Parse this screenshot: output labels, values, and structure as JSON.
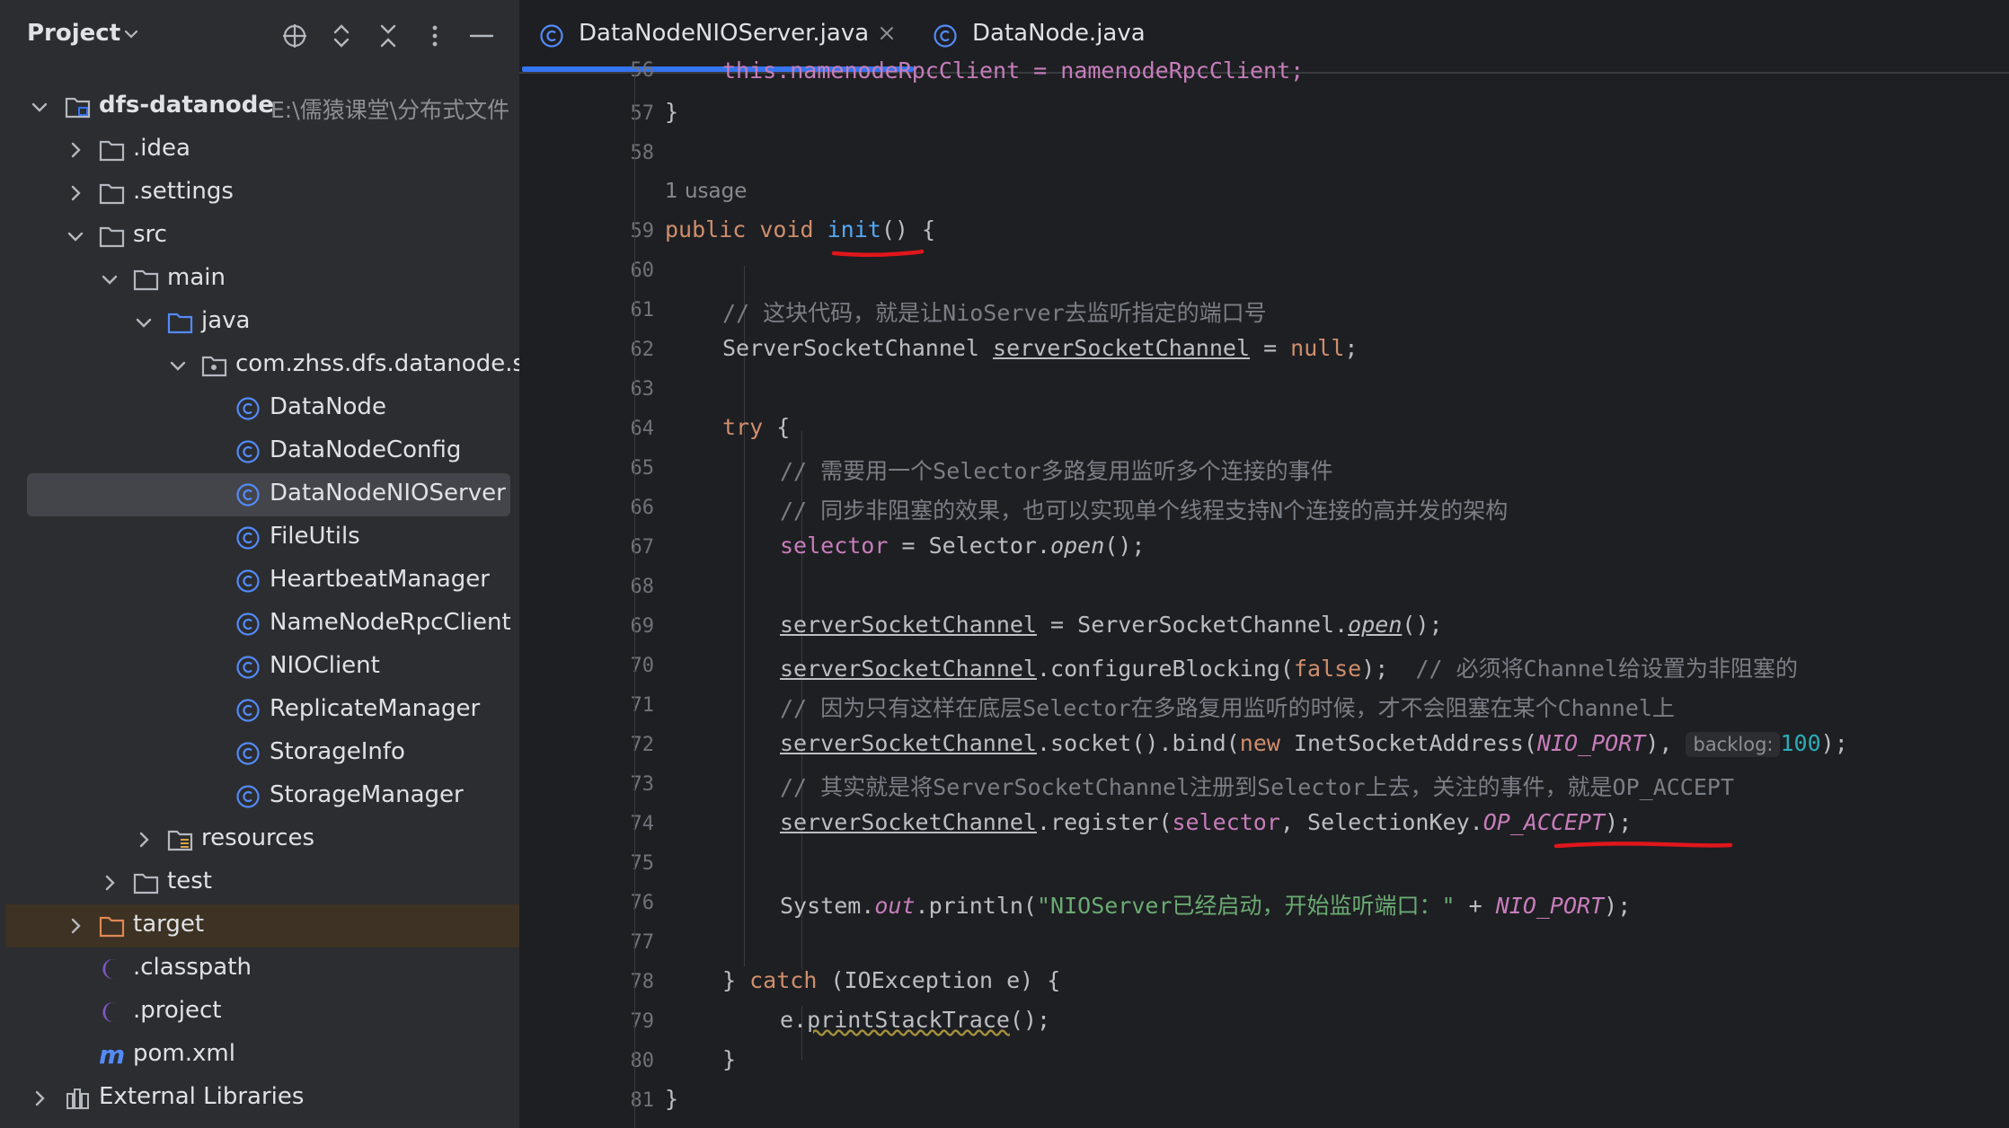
{
  "project_panel": {
    "title": "Project",
    "header_icons": [
      "locate-icon",
      "expand-all-icon",
      "collapse-all-icon",
      "more-options-icon",
      "minimize-icon"
    ],
    "tree": [
      {
        "label": "dfs-datanode",
        "hint": "E:\\儒猿课堂\\分布式文件",
        "type": "module",
        "depth": 0,
        "expanded": true
      },
      {
        "label": ".idea",
        "type": "folder",
        "depth": 1,
        "expanded": false
      },
      {
        "label": ".settings",
        "type": "folder",
        "depth": 1,
        "expanded": false
      },
      {
        "label": "src",
        "type": "folder",
        "depth": 1,
        "expanded": true
      },
      {
        "label": "main",
        "type": "folder",
        "depth": 2,
        "expanded": true
      },
      {
        "label": "java",
        "type": "source-folder",
        "depth": 3,
        "expanded": true
      },
      {
        "label": "com.zhss.dfs.datanode.se",
        "type": "package",
        "depth": 4,
        "expanded": true
      },
      {
        "label": "DataNode",
        "type": "class",
        "depth": 5
      },
      {
        "label": "DataNodeConfig",
        "type": "class",
        "depth": 5
      },
      {
        "label": "DataNodeNIOServer",
        "type": "class",
        "depth": 5,
        "selected": true
      },
      {
        "label": "FileUtils",
        "type": "class",
        "depth": 5
      },
      {
        "label": "HeartbeatManager",
        "type": "class",
        "depth": 5
      },
      {
        "label": "NameNodeRpcClient",
        "type": "class",
        "depth": 5
      },
      {
        "label": "NIOClient",
        "type": "class",
        "depth": 5
      },
      {
        "label": "ReplicateManager",
        "type": "class",
        "depth": 5
      },
      {
        "label": "StorageInfo",
        "type": "class",
        "depth": 5
      },
      {
        "label": "StorageManager",
        "type": "class",
        "depth": 5
      },
      {
        "label": "resources",
        "type": "resources-folder",
        "depth": 3,
        "expanded": false
      },
      {
        "label": "test",
        "type": "folder",
        "depth": 2,
        "expanded": false
      },
      {
        "label": "target",
        "type": "excluded-folder",
        "depth": 1,
        "expanded": false
      },
      {
        "label": ".classpath",
        "type": "eclipse-file",
        "depth": 1
      },
      {
        "label": ".project",
        "type": "eclipse-file",
        "depth": 1
      },
      {
        "label": "pom.xml",
        "type": "maven-file",
        "depth": 1
      },
      {
        "label": "External Libraries",
        "type": "libraries",
        "depth": 0,
        "expanded": false
      }
    ]
  },
  "editor": {
    "tabs": [
      {
        "label": "DataNodeNIOServer.java",
        "active": true,
        "closable": true
      },
      {
        "label": "DataNode.java",
        "active": false
      }
    ],
    "usage_hint": "1 usage",
    "line_numbers": [
      "56",
      "57",
      "58",
      "59",
      "60",
      "61",
      "62",
      "63",
      "64",
      "65",
      "66",
      "67",
      "68",
      "69",
      "70",
      "71",
      "72",
      "73",
      "74",
      "75",
      "76",
      "77",
      "78",
      "79",
      "80",
      "81"
    ],
    "code": {
      "l56": "this.namenodeRpcClient = namenodeRpcClient;",
      "l57": "}",
      "l59_kw": "public void ",
      "l59_fn": "init",
      "l59_rest": "() {",
      "l61": "// 这块代码，就是让NioServer去监听指定的端口号",
      "l62_a": "ServerSocketChannel ",
      "l62_b": "serverSocketChannel",
      "l62_c": " = ",
      "l62_d": "null",
      "l62_e": ";",
      "l64_kw": "try",
      "l64_rest": " {",
      "l65": "// 需要用一个Selector多路复用监听多个连接的事件",
      "l66": "// 同步非阻塞的效果，也可以实现单个线程支持N个连接的高并发的架构",
      "l67_a": "selector",
      "l67_b": " = Selector.",
      "l67_c": "open",
      "l67_d": "();",
      "var": "serverSocketChannel",
      "l69_b": " = ServerSocketChannel.",
      "l69_c": "open",
      "l69_d": "();",
      "l70_b": ".configureBlocking(",
      "l70_c": "false",
      "l70_d": ");  ",
      "l70_e": "// 必须将Channel给设置为非阻塞的",
      "l71": "// 因为只有这样在底层Selector在多路复用监听的时候，才不会阻塞在某个Channel上",
      "l72_b": ".socket().bind(",
      "l72_c": "new",
      "l72_d": " InetSocketAddress(",
      "l72_e": "NIO_PORT",
      "l72_f": "), ",
      "l72_hint": "backlog:",
      "l72_g": "100",
      "l72_h": ");",
      "l73": "// 其实就是将ServerSocketChannel注册到Selector上去，关注的事件，就是OP_ACCEPT",
      "l74_b": ".register(",
      "l74_c": "selector",
      "l74_d": ", SelectionKey.",
      "l74_e": "OP_ACCEPT",
      "l74_f": ");",
      "l76_a": "System.",
      "l76_b": "out",
      "l76_c": ".println(",
      "l76_d": "\"NIOServer已经启动，开始监听端口：\"",
      "l76_e": " + ",
      "l76_f": "NIO_PORT",
      "l76_g": ");",
      "l78_a": "} ",
      "l78_b": "catch",
      "l78_c": " (IOException e) {",
      "l79_a": "e.",
      "l79_b": "printStackTrace",
      "l79_c": "();",
      "l80": "}",
      "l81": "}"
    }
  },
  "colors": {
    "panel_bg": "#2b2d30",
    "editor_bg": "#1e1f22",
    "selection": "#43454a",
    "accent": "#3574f0",
    "keyword": "#cf8e6d",
    "comment": "#7a7e85",
    "field": "#c77dbb",
    "string": "#6aab73",
    "number": "#2aacb8",
    "function": "#56a8f5",
    "annotation_red": "#e0161b"
  }
}
